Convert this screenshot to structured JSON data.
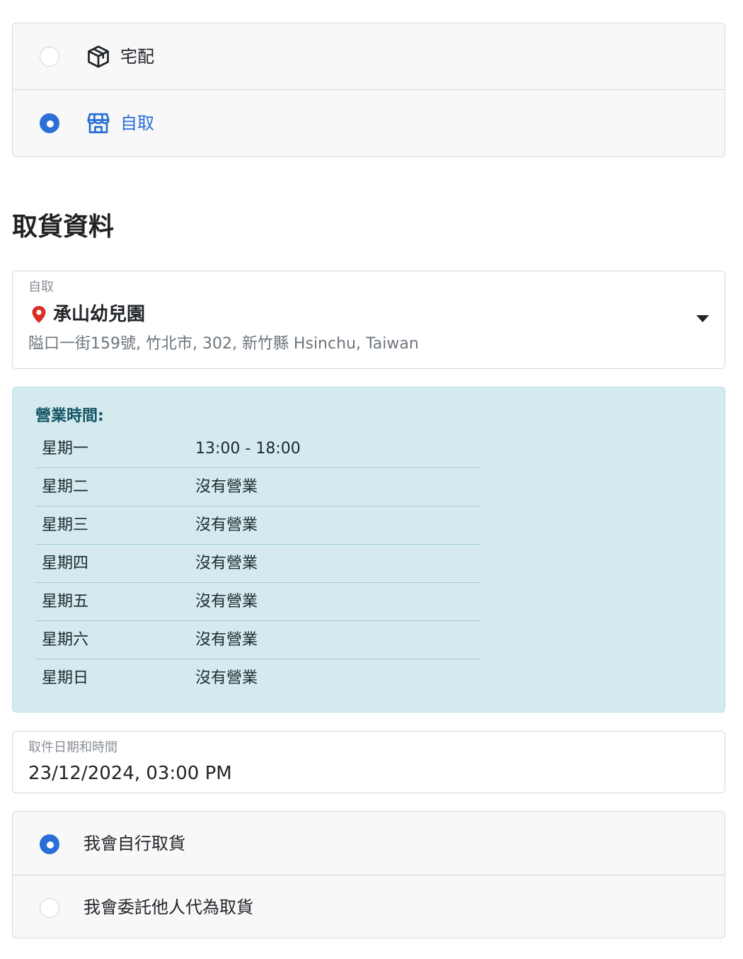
{
  "delivery": {
    "options": [
      {
        "label": "宅配",
        "icon": "package-icon",
        "selected": false
      },
      {
        "label": "自取",
        "icon": "store-icon",
        "selected": true
      }
    ]
  },
  "pickup": {
    "section_title": "取貨資料",
    "store_field_label": "自取",
    "store_name": "承山幼兒園",
    "store_address": "隘口一街159號, 竹北市, 302, 新竹縣 Hsinchu, Taiwan",
    "hours_title": "營業時間:",
    "hours": [
      {
        "day": "星期一",
        "time": "13:00 - 18:00"
      },
      {
        "day": "星期二",
        "time": "沒有營業"
      },
      {
        "day": "星期三",
        "time": "沒有營業"
      },
      {
        "day": "星期四",
        "time": "沒有營業"
      },
      {
        "day": "星期五",
        "time": "沒有營業"
      },
      {
        "day": "星期六",
        "time": "沒有營業"
      },
      {
        "day": "星期日",
        "time": "沒有營業"
      }
    ],
    "datetime_label": "取件日期和時間",
    "datetime_value": "23/12/2024, 03:00 PM",
    "who": [
      {
        "label": "我會自行取貨",
        "selected": true
      },
      {
        "label": "我會委託他人代為取貨",
        "selected": false
      }
    ]
  },
  "colors": {
    "accent": "#2a6fd6",
    "pin": "#d93025",
    "hours_bg": "#d5eaef",
    "hours_title": "#125364"
  }
}
